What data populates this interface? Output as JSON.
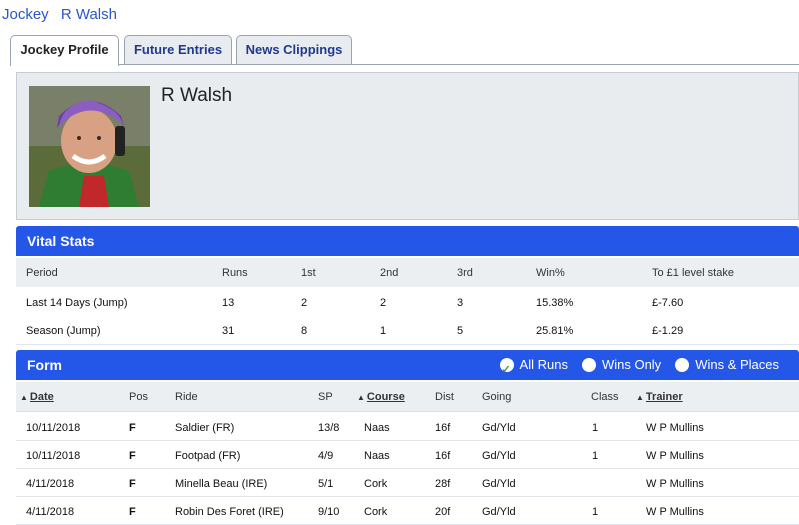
{
  "breadcrumb": {
    "section": "Jockey",
    "name": "R Walsh"
  },
  "tabs": [
    "Jockey Profile",
    "Future Entries",
    "News Clippings"
  ],
  "profile": {
    "name": "R Walsh",
    "photo_alt": "jockey-photo"
  },
  "vital_stats": {
    "title": "Vital Stats",
    "columns": [
      "Period",
      "Runs",
      "1st",
      "2nd",
      "3rd",
      "Win%",
      "To £1 level stake"
    ],
    "rows": [
      [
        "Last 14 Days (Jump)",
        "13",
        "2",
        "2",
        "3",
        "15.38%",
        "£-7.60"
      ],
      [
        "Season (Jump)",
        "31",
        "8",
        "1",
        "5",
        "25.81%",
        "£-1.29"
      ]
    ]
  },
  "form": {
    "title": "Form",
    "filters": [
      {
        "label": "All Runs",
        "checked": true
      },
      {
        "label": "Wins Only",
        "checked": false
      },
      {
        "label": "Wins & Places",
        "checked": false
      }
    ],
    "columns": [
      "Date",
      "Pos",
      "Ride",
      "SP",
      "Course",
      "Dist",
      "Going",
      "Class",
      "Trainer"
    ],
    "rows": [
      [
        "10/11/2018",
        "F",
        "Saldier (FR)",
        "13/8",
        "Naas",
        "16f",
        "Gd/Yld",
        "1",
        "W P Mullins"
      ],
      [
        "10/11/2018",
        "F",
        "Footpad (FR)",
        "4/9",
        "Naas",
        "16f",
        "Gd/Yld",
        "1",
        "W P Mullins"
      ],
      [
        "4/11/2018",
        "F",
        "Minella Beau (IRE)",
        "5/1",
        "Cork",
        "28f",
        "Gd/Yld",
        "",
        "W P Mullins"
      ],
      [
        "4/11/2018",
        "F",
        "Robin Des Foret (IRE)",
        "9/10",
        "Cork",
        "20f",
        "Gd/Yld",
        "1",
        "W P Mullins"
      ]
    ]
  },
  "colors": {
    "accent": "#2456e8",
    "link": "#2a57c9",
    "panel": "#e9ecef"
  }
}
